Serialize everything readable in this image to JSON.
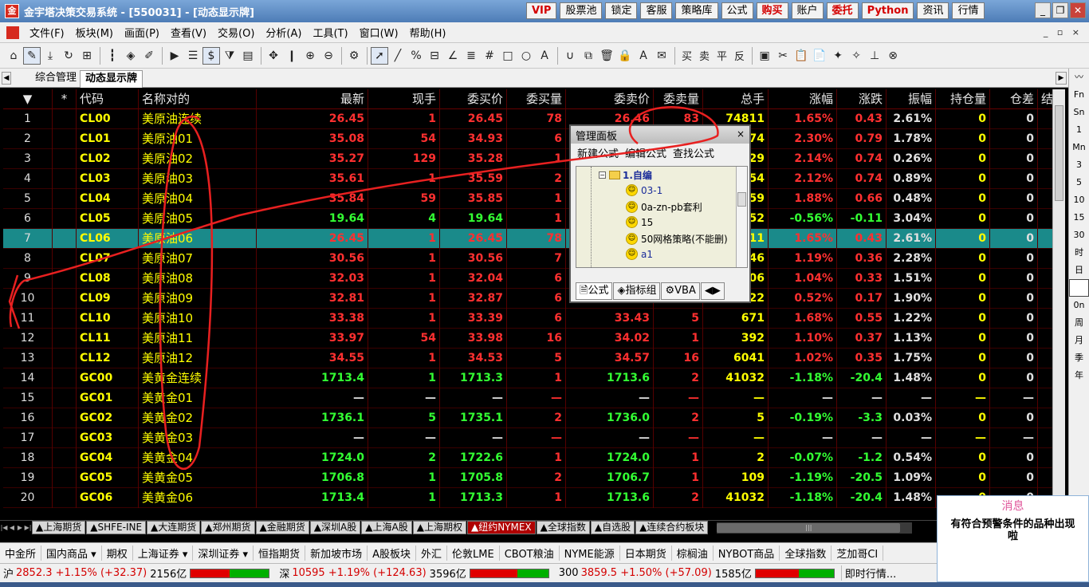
{
  "titlebar": {
    "logo": "金",
    "title": "金宇塔决策交易系统 - [550031] - [动态显示牌]",
    "buttons": [
      "VIP",
      "股票池",
      "锁定",
      "客服",
      "策略库",
      "公式",
      "购买",
      "账户",
      "委托",
      "Python",
      "资讯",
      "行情"
    ]
  },
  "menu": {
    "items": [
      "文件(F)",
      "板块(M)",
      "画面(P)",
      "查看(V)",
      "交易(O)",
      "分析(A)",
      "工具(T)",
      "窗口(W)",
      "帮助(H)"
    ],
    "mdi_controls": "_ ▫ ×"
  },
  "toolbar": {
    "text_tools": [
      "买",
      "卖",
      "平",
      "反"
    ]
  },
  "page_tabs": [
    "综合管理",
    "动态显示牌"
  ],
  "right_sidebar": [
    "Fn",
    "Sn",
    "1",
    "Mn",
    "3",
    "5",
    "10",
    "15",
    "30",
    "时",
    "日",
    "",
    "0n",
    "周",
    "月",
    "季",
    "年"
  ],
  "grid": {
    "headers": {
      "idx": "▼",
      "star": "*",
      "code": "代码",
      "name": "名称对的",
      "last": "最新",
      "vol": "现手",
      "bid": "委买价",
      "bidv": "委买量",
      "ask": "委卖价",
      "askv": "委卖量",
      "total": "总手",
      "chg": "涨幅",
      "diff": "涨跌",
      "amp": "振幅",
      "oi": "持仓量",
      "oid": "仓差",
      "more": "结"
    },
    "rows": [
      {
        "idx": "1",
        "code": "CL00",
        "name": "美原油连续",
        "last": "26.45",
        "vol": "1",
        "bid": "26.45",
        "bidv": "78",
        "ask": "26.46",
        "askv": "83",
        "total": "74811",
        "chg": "1.65%",
        "diff": "0.43",
        "amp": "2.61%",
        "oi": "0",
        "oid": "0",
        "dir": "up"
      },
      {
        "idx": "2",
        "code": "CL01",
        "name": "美原油01",
        "last": "35.08",
        "vol": "54",
        "bid": "34.93",
        "bidv": "6",
        "ask": "",
        "askv": "",
        "total": "74",
        "chg": "2.30%",
        "diff": "0.79",
        "amp": "1.78%",
        "oi": "0",
        "oid": "0",
        "dir": "up"
      },
      {
        "idx": "3",
        "code": "CL02",
        "name": "美原油02",
        "last": "35.27",
        "vol": "129",
        "bid": "35.28",
        "bidv": "1",
        "ask": "",
        "askv": "",
        "total": "29",
        "chg": "2.14%",
        "diff": "0.74",
        "amp": "0.26%",
        "oi": "0",
        "oid": "0",
        "dir": "up"
      },
      {
        "idx": "4",
        "code": "CL03",
        "name": "美原油03",
        "last": "35.61",
        "vol": "1",
        "bid": "35.59",
        "bidv": "2",
        "ask": "",
        "askv": "",
        "total": "54",
        "chg": "2.12%",
        "diff": "0.74",
        "amp": "0.89%",
        "oi": "0",
        "oid": "0",
        "dir": "up"
      },
      {
        "idx": "5",
        "code": "CL04",
        "name": "美原油04",
        "last": "35.84",
        "vol": "59",
        "bid": "35.85",
        "bidv": "1",
        "ask": "",
        "askv": "",
        "total": "59",
        "chg": "1.88%",
        "diff": "0.66",
        "amp": "0.48%",
        "oi": "0",
        "oid": "0",
        "dir": "up"
      },
      {
        "idx": "6",
        "code": "CL05",
        "name": "美原油05",
        "last": "19.64",
        "vol": "4",
        "bid": "19.64",
        "bidv": "1",
        "ask": "",
        "askv": "",
        "total": "52",
        "chg": "-0.56%",
        "diff": "-0.11",
        "amp": "3.04%",
        "oi": "0",
        "oid": "0",
        "dir": "dn"
      },
      {
        "idx": "7",
        "code": "CL06",
        "name": "美原油06",
        "last": "26.45",
        "vol": "1",
        "bid": "26.45",
        "bidv": "78",
        "ask": "",
        "askv": "",
        "total": "11",
        "chg": "1.65%",
        "diff": "0.43",
        "amp": "2.61%",
        "oi": "0",
        "oid": "0",
        "dir": "up",
        "selected": true
      },
      {
        "idx": "8",
        "code": "CL07",
        "name": "美原油07",
        "last": "30.56",
        "vol": "1",
        "bid": "30.56",
        "bidv": "7",
        "ask": "",
        "askv": "",
        "total": "46",
        "chg": "1.19%",
        "diff": "0.36",
        "amp": "2.28%",
        "oi": "0",
        "oid": "0",
        "dir": "up"
      },
      {
        "idx": "9",
        "code": "CL08",
        "name": "美原油08",
        "last": "32.03",
        "vol": "1",
        "bid": "32.04",
        "bidv": "6",
        "ask": "",
        "askv": "",
        "total": "06",
        "chg": "1.04%",
        "diff": "0.33",
        "amp": "1.51%",
        "oi": "0",
        "oid": "0",
        "dir": "up"
      },
      {
        "idx": "10",
        "code": "CL09",
        "name": "美原油09",
        "last": "32.81",
        "vol": "1",
        "bid": "32.87",
        "bidv": "6",
        "ask": "",
        "askv": "",
        "total": "22",
        "chg": "0.52%",
        "diff": "0.17",
        "amp": "1.90%",
        "oi": "0",
        "oid": "0",
        "dir": "up"
      },
      {
        "idx": "11",
        "code": "CL10",
        "name": "美原油10",
        "last": "33.38",
        "vol": "1",
        "bid": "33.39",
        "bidv": "6",
        "ask": "33.43",
        "askv": "5",
        "total": "671",
        "chg": "1.68%",
        "diff": "0.55",
        "amp": "1.22%",
        "oi": "0",
        "oid": "0",
        "dir": "up"
      },
      {
        "idx": "12",
        "code": "CL11",
        "name": "美原油11",
        "last": "33.97",
        "vol": "54",
        "bid": "33.98",
        "bidv": "16",
        "ask": "34.02",
        "askv": "1",
        "total": "392",
        "chg": "1.10%",
        "diff": "0.37",
        "amp": "1.13%",
        "oi": "0",
        "oid": "0",
        "dir": "up"
      },
      {
        "idx": "13",
        "code": "CL12",
        "name": "美原油12",
        "last": "34.55",
        "vol": "1",
        "bid": "34.53",
        "bidv": "5",
        "ask": "34.57",
        "askv": "16",
        "total": "6041",
        "chg": "1.02%",
        "diff": "0.35",
        "amp": "1.75%",
        "oi": "0",
        "oid": "0",
        "dir": "up"
      },
      {
        "idx": "14",
        "code": "GC00",
        "name": "美黄金连续",
        "last": "1713.4",
        "vol": "1",
        "bid": "1713.3",
        "bidv": "1",
        "ask": "1713.6",
        "askv": "2",
        "total": "41032",
        "chg": "-1.18%",
        "diff": "-20.4",
        "amp": "1.48%",
        "oi": "0",
        "oid": "0",
        "dir": "dn"
      },
      {
        "idx": "15",
        "code": "GC01",
        "name": "美黄金01",
        "last": "—",
        "vol": "—",
        "bid": "—",
        "bidv": "—",
        "ask": "—",
        "askv": "—",
        "total": "—",
        "chg": "—",
        "diff": "—",
        "amp": "—",
        "oi": "—",
        "oid": "—",
        "dir": "eq"
      },
      {
        "idx": "16",
        "code": "GC02",
        "name": "美黄金02",
        "last": "1736.1",
        "vol": "5",
        "bid": "1735.1",
        "bidv": "2",
        "ask": "1736.0",
        "askv": "2",
        "total": "5",
        "chg": "-0.19%",
        "diff": "-3.3",
        "amp": "0.03%",
        "oi": "0",
        "oid": "0",
        "dir": "dn"
      },
      {
        "idx": "17",
        "code": "GC03",
        "name": "美黄金03",
        "last": "—",
        "vol": "—",
        "bid": "—",
        "bidv": "—",
        "ask": "—",
        "askv": "—",
        "total": "—",
        "chg": "—",
        "diff": "—",
        "amp": "—",
        "oi": "—",
        "oid": "—",
        "dir": "eq"
      },
      {
        "idx": "18",
        "code": "GC04",
        "name": "美黄金04",
        "last": "1724.0",
        "vol": "2",
        "bid": "1722.6",
        "bidv": "1",
        "ask": "1724.0",
        "askv": "1",
        "total": "2",
        "chg": "-0.07%",
        "diff": "-1.2",
        "amp": "0.54%",
        "oi": "0",
        "oid": "0",
        "dir": "dn"
      },
      {
        "idx": "19",
        "code": "GC05",
        "name": "美黄金05",
        "last": "1706.8",
        "vol": "1",
        "bid": "1705.8",
        "bidv": "2",
        "ask": "1706.7",
        "askv": "1",
        "total": "109",
        "chg": "-1.19%",
        "diff": "-20.5",
        "amp": "1.09%",
        "oi": "0",
        "oid": "0",
        "dir": "dn"
      },
      {
        "idx": "20",
        "code": "GC06",
        "name": "美黄金06",
        "last": "1713.4",
        "vol": "1",
        "bid": "1713.3",
        "bidv": "1",
        "ask": "1713.6",
        "askv": "2",
        "total": "41032",
        "chg": "-1.18%",
        "diff": "-20.4",
        "amp": "1.48%",
        "oi": "0",
        "oid": "0",
        "dir": "dn"
      }
    ]
  },
  "sheet_tabs": [
    "上海期货",
    "SHFE-INE",
    "大连期货",
    "郑州期货",
    "金融期货",
    "深圳A股",
    "上海A股",
    "上海期权",
    "纽约NYMEX",
    "全球指数",
    "自选股",
    "连续合约板块"
  ],
  "sheet_tab_active": "纽约NYMEX",
  "market_bar": [
    "中金所",
    "国内商品 ▾",
    "期权",
    "上海证券 ▾",
    "深圳证券 ▾",
    "恒指期货",
    "新加坡市场",
    "A股板块",
    "外汇",
    "伦敦LME",
    "CBOT粮油",
    "NYME能源",
    "日本期货",
    "棕榈油",
    "NYBOT商品",
    "全球指数",
    "芝加哥CI"
  ],
  "status": {
    "sh_label": "沪",
    "sh_value": "2852.3 +1.15% (+32.37)",
    "sh_amount": "2156亿",
    "sz_label": "深",
    "sz_value": "10595 +1.19% (+124.63)",
    "sz_amount": "3596亿",
    "c300_label": "300",
    "c300_value": "3859.5 +1.50% (+57.09)",
    "c300_amount": "1585亿",
    "realtime": "即时行情..."
  },
  "alert": {
    "title": "消息",
    "message": "有符合预警条件的品种出现啦"
  },
  "panel": {
    "title": "管理面板",
    "close": "×",
    "menu": [
      "新建公式",
      "编辑公式",
      "查找公式"
    ],
    "folder": "1.自编",
    "items": [
      "03-1",
      "0a-zn-pb套利",
      "15",
      "50网格策略(不能删)",
      "a1"
    ],
    "tabs": [
      "公式",
      "指标组",
      "VBA"
    ]
  },
  "colors": {
    "up": "#ff3030",
    "down": "#33ff33",
    "code": "#ffff00",
    "selected_row": "#1a8a8a",
    "annotation": "#e82020"
  }
}
